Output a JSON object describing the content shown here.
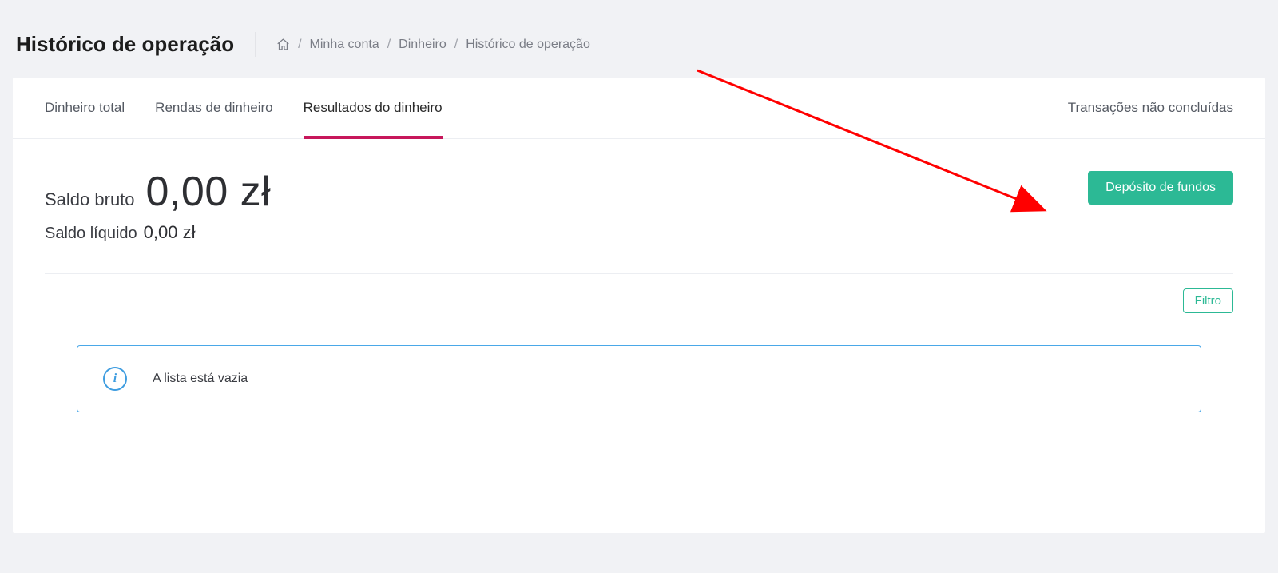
{
  "header": {
    "title": "Histórico de operação",
    "breadcrumb": {
      "home_label": "Home",
      "item1": "Minha conta",
      "item2": "Dinheiro",
      "current": "Histórico de operação"
    }
  },
  "tabs": {
    "total": "Dinheiro total",
    "income": "Rendas de dinheiro",
    "results": "Resultados do dinheiro",
    "pending": "Transações não concluídas"
  },
  "balance": {
    "gross_label": "Saldo  bruto",
    "gross_value": "0,00 zł",
    "net_label": "Saldo líquido",
    "net_value": "0,00 zł"
  },
  "actions": {
    "deposit": "Depósito de fundos",
    "filter": "Filtro"
  },
  "info": {
    "empty_list": "A lista está vazia"
  }
}
